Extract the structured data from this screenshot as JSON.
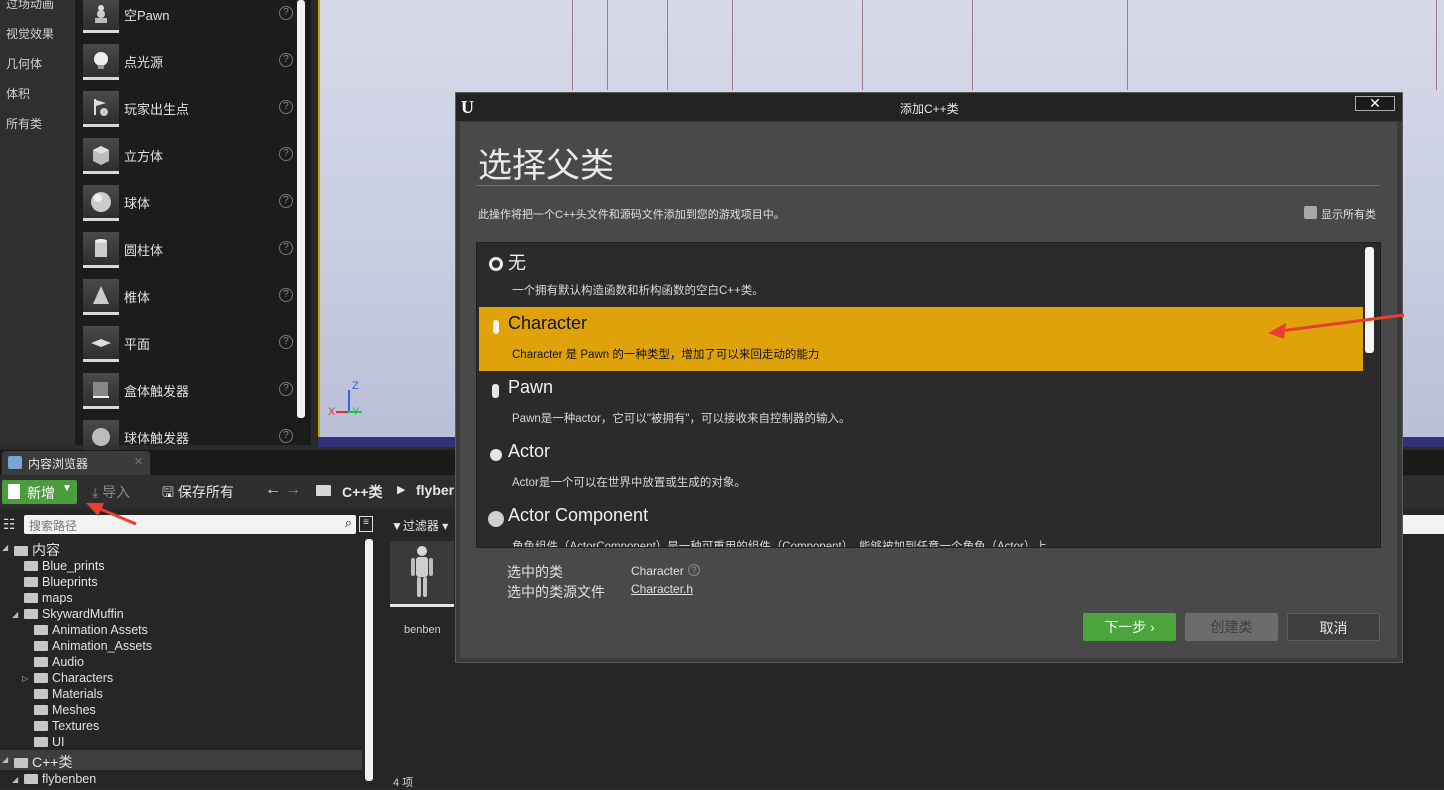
{
  "categories": [
    "过场动画",
    "视觉效果",
    "几何体",
    "体积",
    "所有类"
  ],
  "place_items": [
    {
      "label": "空Pawn",
      "icon": "pawn-icon"
    },
    {
      "label": "点光源",
      "icon": "light-bulb-icon"
    },
    {
      "label": "玩家出生点",
      "icon": "player-start-icon"
    },
    {
      "label": "立方体",
      "icon": "cube-icon"
    },
    {
      "label": "球体",
      "icon": "sphere-icon"
    },
    {
      "label": "圆柱体",
      "icon": "cylinder-icon"
    },
    {
      "label": "椎体",
      "icon": "cone-icon"
    },
    {
      "label": "平面",
      "icon": "plane-icon"
    },
    {
      "label": "盒体触发器",
      "icon": "box-trigger-icon"
    },
    {
      "label": "球体触发器",
      "icon": "sphere-trigger-icon"
    }
  ],
  "viewport": {
    "axis_z": "Z",
    "axis_x": "X",
    "axis_y": "Y"
  },
  "content_browser": {
    "tab_label": "内容浏览器",
    "new_label": "新增",
    "import_label": "导入",
    "save_all_label": "保存所有",
    "path": [
      "C++类",
      "flyber"
    ],
    "search_placeholder": "搜索路径",
    "filter_label": "过滤器",
    "tree": [
      {
        "label": "内容",
        "level": 0,
        "expanded": true,
        "root": true
      },
      {
        "label": "Blue_prints",
        "level": 1
      },
      {
        "label": "Blueprints",
        "level": 1
      },
      {
        "label": "maps",
        "level": 1
      },
      {
        "label": "SkywardMuffin",
        "level": 1,
        "expanded": true
      },
      {
        "label": "Animation Assets",
        "level": 2
      },
      {
        "label": "Animation_Assets",
        "level": 2
      },
      {
        "label": "Audio",
        "level": 2
      },
      {
        "label": "Characters",
        "level": 2,
        "collapsed": true
      },
      {
        "label": "Materials",
        "level": 2
      },
      {
        "label": "Meshes",
        "level": 2
      },
      {
        "label": "Textures",
        "level": 2
      },
      {
        "label": "UI",
        "level": 2
      },
      {
        "label": "C++类",
        "level": 0,
        "expanded": true,
        "root": true
      },
      {
        "label": "flybenben",
        "level": 1
      }
    ],
    "asset_name": "benben",
    "item_count": "4 项"
  },
  "dialog": {
    "title": "添加C++类",
    "heading": "选择父类",
    "description": "此操作将把一个C++头文件和源码文件添加到您的游戏项目中。",
    "show_all_label": "显示所有类",
    "classes": [
      {
        "name": "无",
        "desc": "一个拥有默认构造函数和析构函数的空白C++类。",
        "icon": "none-icon"
      },
      {
        "name": "Character",
        "desc": "Character 是 Pawn 的一种类型，增加了可以来回走动的能力",
        "icon": "character-icon",
        "selected": true
      },
      {
        "name": "Pawn",
        "desc": "Pawn是一种actor，它可以\"被拥有\"，可以接收来自控制器的输入。",
        "icon": "pawn-icon"
      },
      {
        "name": "Actor",
        "desc": "Actor是一个可以在世界中放置或生成的对象。",
        "icon": "actor-icon"
      },
      {
        "name": "Actor Component",
        "desc": "角色组件（ActorComponent）是一种可重用的组件（Component），能够被加到任意一个角色（Actor）上",
        "icon": "actor-component-icon"
      }
    ],
    "selected_class_label": "选中的类",
    "selected_class_value": "Character",
    "selected_source_label": "选中的类源文件",
    "selected_source_value": "Character.h",
    "next_label": "下一步",
    "create_label": "创建类",
    "cancel_label": "取消"
  },
  "colors": {
    "selected": "#e0a20a",
    "accent_green": "#4b9d3c",
    "annotation_arrow": "#e83f2e"
  }
}
